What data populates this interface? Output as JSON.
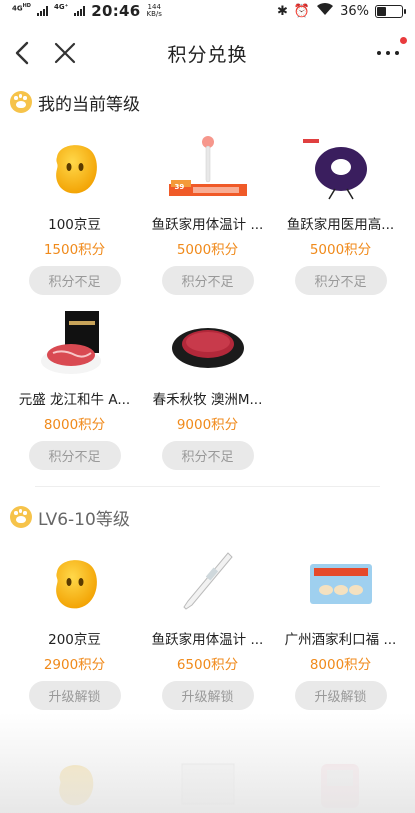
{
  "statusbar": {
    "network": "4G HD 4G+",
    "time": "20:46",
    "speed_value": "144",
    "speed_unit": "KB/s",
    "battery": "36%"
  },
  "navbar": {
    "title": "积分兑换"
  },
  "sections": [
    {
      "title": "我的当前等级",
      "items": [
        {
          "name": "100京豆",
          "price": "1500积分",
          "button": "积分不足"
        },
        {
          "name": "鱼跃家用体温计 ...",
          "price": "5000积分",
          "button": "积分不足",
          "tag": "39"
        },
        {
          "name": "鱼跃家用医用高...",
          "price": "5000积分",
          "button": "积分不足"
        },
        {
          "name": "元盛 龙江和牛 A...",
          "price": "8000积分",
          "button": "积分不足"
        },
        {
          "name": "春禾秋牧 澳洲M...",
          "price": "9000积分",
          "button": "积分不足"
        }
      ]
    },
    {
      "title": "LV6-10等级",
      "items": [
        {
          "name": "200京豆",
          "price": "2900积分",
          "button": "升级解锁"
        },
        {
          "name": "鱼跃家用体温计 ...",
          "price": "6500积分",
          "button": "升级解锁"
        },
        {
          "name": "广州酒家利口福 ...",
          "price": "8000积分",
          "button": "升级解锁"
        }
      ]
    }
  ],
  "colors": {
    "price": "#f08a1b",
    "accent": "#f6c34a",
    "button_bg": "#e9e9e9"
  }
}
